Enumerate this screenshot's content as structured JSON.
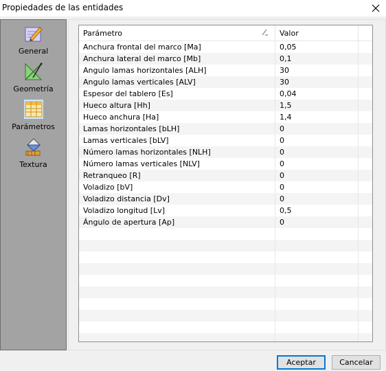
{
  "window": {
    "title": "Propiedades de las entidades"
  },
  "sidebar": {
    "items": [
      {
        "label": "General",
        "icon": "pencil-icon"
      },
      {
        "label": "Geometría",
        "icon": "geometry-icon"
      },
      {
        "label": "Parámetros",
        "icon": "table-icon",
        "selected": true
      },
      {
        "label": "Textura",
        "icon": "paint-bucket-icon"
      }
    ]
  },
  "grid": {
    "columns": [
      "Parámetro",
      "Valor"
    ],
    "rows": [
      {
        "name": "Anchura frontal del marco [Ma]",
        "value": "0,05"
      },
      {
        "name": "Anchura lateral del marco [Mb]",
        "value": "0,1"
      },
      {
        "name": "Angulo lamas horizontales [ALH]",
        "value": "30"
      },
      {
        "name": "Angulo lamas verticales [ALV]",
        "value": "30"
      },
      {
        "name": "Espesor del tablero [Es]",
        "value": "0,04"
      },
      {
        "name": "Hueco altura [Hh]",
        "value": "1,5"
      },
      {
        "name": "Hueco anchura [Ha]",
        "value": "1,4"
      },
      {
        "name": "Lamas horizontales [bLH]",
        "value": "0"
      },
      {
        "name": "Lamas verticales [bLV]",
        "value": "0"
      },
      {
        "name": "Número lamas horizontales [NLH]",
        "value": "0"
      },
      {
        "name": "Número lamas verticales [NLV]",
        "value": "0"
      },
      {
        "name": "Retranqueo [R]",
        "value": "0"
      },
      {
        "name": "Voladizo [bV]",
        "value": "0"
      },
      {
        "name": "Voladizo distancia [Dv]",
        "value": "0"
      },
      {
        "name": "Voladizo longitud [Lv]",
        "value": "0,5"
      },
      {
        "name": "Ángulo de apertura [Ap]",
        "value": "0"
      }
    ]
  },
  "buttons": {
    "accept": "Aceptar",
    "cancel": "Cancelar"
  }
}
